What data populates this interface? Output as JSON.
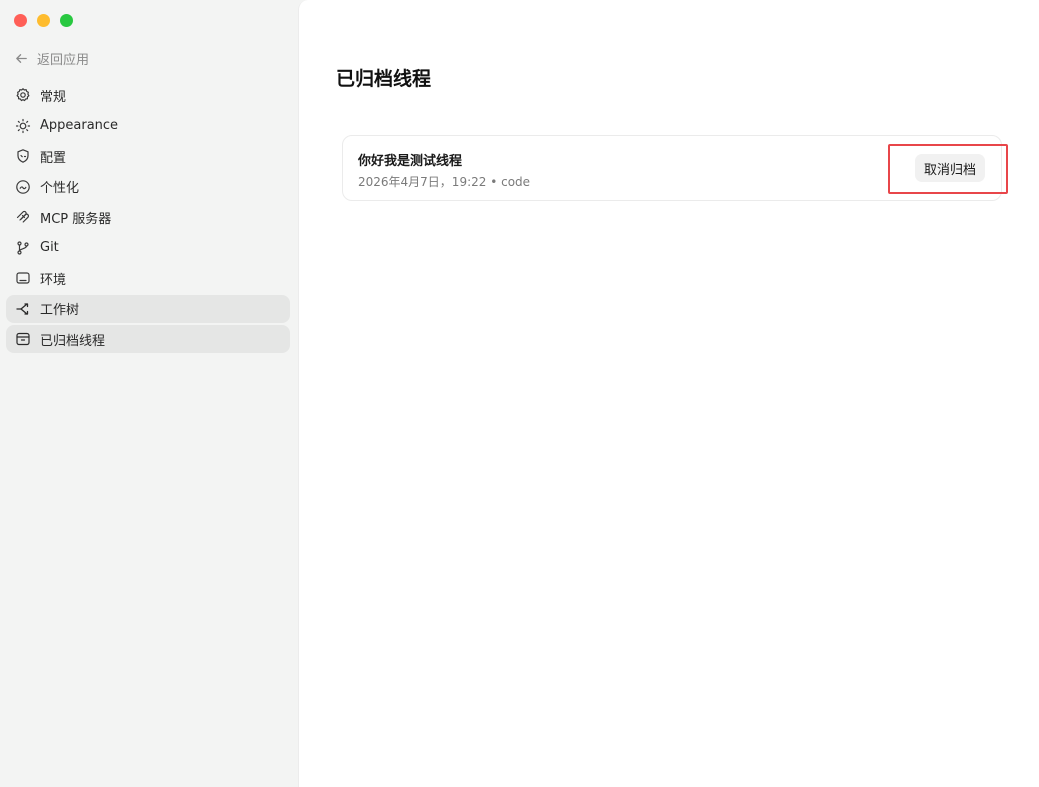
{
  "window": {
    "traffic_lights": [
      "close",
      "minimize",
      "zoom"
    ]
  },
  "sidebar": {
    "back_label": "返回应用",
    "items": [
      {
        "label": "常规",
        "icon": "gear-icon",
        "active": false
      },
      {
        "label": "Appearance",
        "icon": "sun-icon",
        "active": false
      },
      {
        "label": "配置",
        "icon": "shield-icon",
        "active": false
      },
      {
        "label": "个性化",
        "icon": "palette-icon",
        "active": false
      },
      {
        "label": "MCP 服务器",
        "icon": "mcp-icon",
        "active": false
      },
      {
        "label": "Git",
        "icon": "git-branch-icon",
        "active": false
      },
      {
        "label": "环境",
        "icon": "monitor-icon",
        "active": false
      },
      {
        "label": "工作树",
        "icon": "worktree-icon",
        "active": true
      },
      {
        "label": "已归档线程",
        "icon": "archive-icon",
        "active": true
      }
    ]
  },
  "main": {
    "title": "已归档线程",
    "threads": [
      {
        "title": "你好我是测试线程",
        "meta": "2026年4月7日，19:22 • code",
        "action_label": "取消归档"
      }
    ]
  },
  "colors": {
    "sidebar_bg": "#f3f4f3",
    "main_bg": "#ffffff",
    "active_item_bg": "#e5e6e5",
    "highlight_border": "#e8464a"
  }
}
